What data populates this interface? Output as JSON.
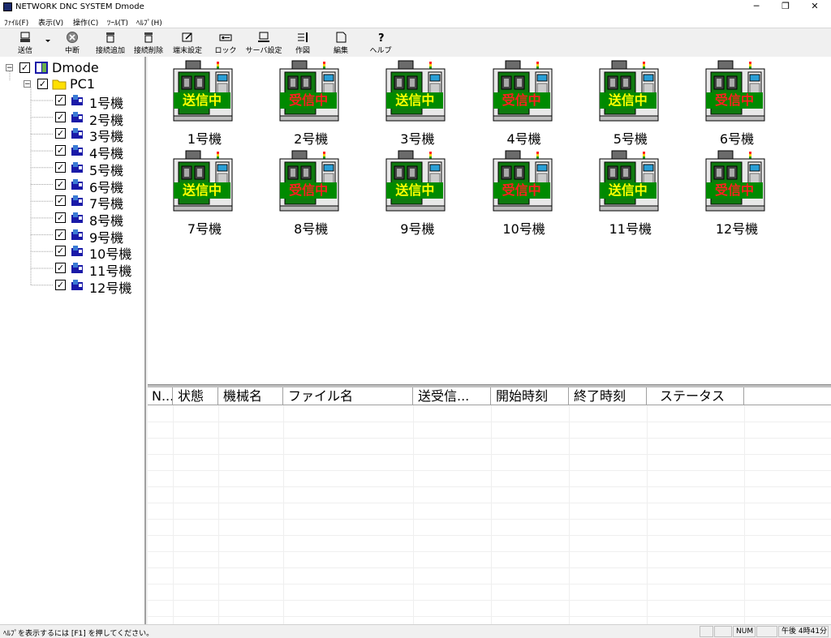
{
  "window": {
    "title": "NETWORK DNC SYSTEM Dmode",
    "minimize": "─",
    "restore": "❐",
    "close": "✕"
  },
  "menu": [
    "ﾌｧｲﾙ(F)",
    "表示(V)",
    "操作(C)",
    "ﾂｰﾙ(T)",
    "ﾍﾙﾌﾟ(H)"
  ],
  "toolbar": {
    "send": "送信",
    "stop": "中断",
    "add_connection": "接続追加",
    "delete_connection": "接続削除",
    "terminal_settings": "端末設定",
    "lock": "ロック",
    "server_settings": "サーバ設定",
    "drawing": "作図",
    "edit": "編集",
    "help": "ヘルプ"
  },
  "tree": {
    "root": "Dmode",
    "pc": "PC1",
    "machines": [
      "1号機",
      "2号機",
      "3号機",
      "4号機",
      "5号機",
      "6号機",
      "7号機",
      "8号機",
      "9号機",
      "10号機",
      "11号機",
      "12号機"
    ]
  },
  "machines": [
    {
      "name": "1号機",
      "status": "送信中",
      "kind": "send"
    },
    {
      "name": "2号機",
      "status": "受信中",
      "kind": "recv"
    },
    {
      "name": "3号機",
      "status": "送信中",
      "kind": "send"
    },
    {
      "name": "4号機",
      "status": "受信中",
      "kind": "recv"
    },
    {
      "name": "5号機",
      "status": "送信中",
      "kind": "send"
    },
    {
      "name": "6号機",
      "status": "受信中",
      "kind": "recv"
    },
    {
      "name": "7号機",
      "status": "送信中",
      "kind": "send"
    },
    {
      "name": "8号機",
      "status": "受信中",
      "kind": "recv"
    },
    {
      "name": "9号機",
      "status": "送信中",
      "kind": "send"
    },
    {
      "name": "10号機",
      "status": "受信中",
      "kind": "recv"
    },
    {
      "name": "11号機",
      "status": "送信中",
      "kind": "send"
    },
    {
      "name": "12号機",
      "status": "受信中",
      "kind": "recv"
    }
  ],
  "log": {
    "columns": [
      "N...",
      "状態",
      "機械名",
      "ファイル名",
      "送受信...",
      "開始時刻",
      "終了時刻",
      "ステータス"
    ]
  },
  "statusbar": {
    "help_text": "ﾍﾙﾌﾟを表示するには [F1] を押してください。",
    "num": "NUM",
    "time": "午後 4時41分"
  },
  "colors": {
    "machine_green": "#008a00",
    "send_text": "#ffff00",
    "recv_text": "#ff2020"
  }
}
